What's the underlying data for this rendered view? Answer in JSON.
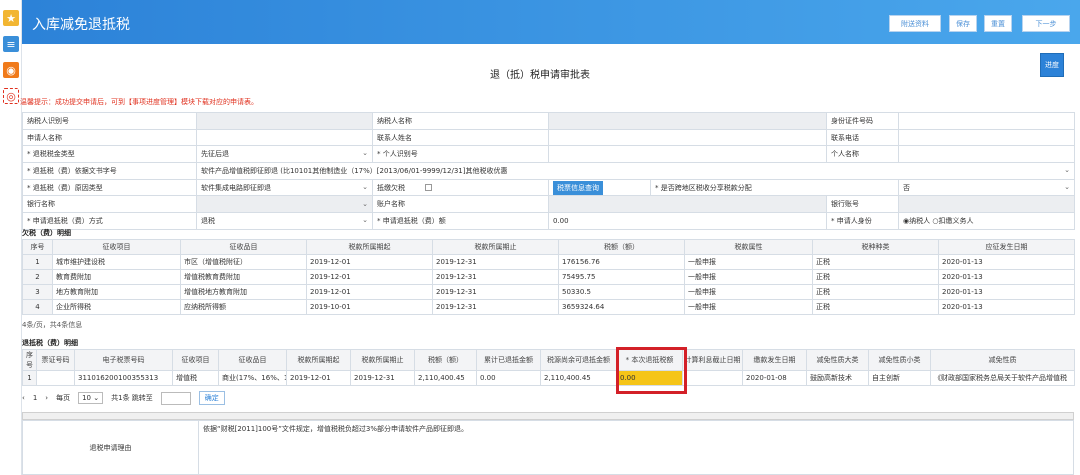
{
  "header": {
    "title": "入库减免退抵税",
    "buttons": [
      "附送资料",
      "保存",
      "重置",
      "下一步"
    ]
  },
  "main_title": "退（抵）税申请审批表",
  "progress_label": "进度",
  "tip": "温馨提示：成功提交申请后，可到【事项进度管理】模块下载对应的申请表。",
  "form": {
    "r1": [
      "纳税人识别号",
      "纳税人名称",
      "身份证件号码"
    ],
    "r2": [
      "申请人名称",
      "联系人姓名",
      "联系电话"
    ],
    "r3": [
      "* 退税税金类型",
      "先征后退",
      "* 个人识别号",
      "个人名称"
    ],
    "r4": [
      "* 退抵税（费）依据文书字号",
      "软件产品增值税即征即退 (比10101其他制造业（17%）[2013/06/01-9999/12/31]其他税收优惠"
    ],
    "r5": [
      "* 退抵税（费）原因类型",
      "软件集成电路即征即退",
      "抵缴欠税",
      "税票信息查询",
      "* 是否跨地区税收分享税款分配",
      "否"
    ],
    "r6": [
      "银行名称",
      "账户名称",
      "银行账号"
    ],
    "r7": [
      "* 申请退抵税（费）方式",
      "退税",
      "* 申请退抵税（费）额",
      "0.00",
      "* 申请人身份",
      "纳税人",
      "扣缴义务人"
    ]
  },
  "owed_section": {
    "title": "欠税（费）明细",
    "headers": [
      "序号",
      "征收项目",
      "征收品目",
      "税款所属期起",
      "税款所属期止",
      "税额（额）",
      "税款属性",
      "税种种类",
      "应征发生日期"
    ],
    "rows": [
      [
        "1",
        "城市维护建设税",
        "市区（增值税附征）",
        "2019-12-01",
        "2019-12-31",
        "176156.76",
        "一般申报",
        "正税",
        "2020-01-13"
      ],
      [
        "2",
        "教育费附加",
        "增值税教育费附加",
        "2019-12-01",
        "2019-12-31",
        "75495.75",
        "一般申报",
        "正税",
        "2020-01-13"
      ],
      [
        "3",
        "地方教育附加",
        "增值税地方教育附加",
        "2019-12-01",
        "2019-12-31",
        "50330.5",
        "一般申报",
        "正税",
        "2020-01-13"
      ],
      [
        "4",
        "企业所得税",
        "应纳税所得额",
        "2019-10-01",
        "2019-12-31",
        "3659324.64",
        "一般申报",
        "正税",
        "2020-01-13"
      ]
    ],
    "footer": "4条/页，共4条信息"
  },
  "refund_section": {
    "title": "退抵税（费）明细",
    "headers": [
      "序号",
      "票证号码",
      "电子税票号码",
      "征收项目",
      "征收品目",
      "税款所属期起",
      "税款所属期止",
      "税额（额）",
      "累计已退抵金额",
      "税源尚余可退抵金额",
      "* 本次退抵税额",
      "计算利息截止日期",
      "缴款发生日期",
      "减免性质大类",
      "减免性质小类",
      "减免性质"
    ],
    "row": [
      "1",
      "",
      "311016200100355313",
      "增值税",
      "商业(17%、16%、1…",
      "2019-12-01",
      "2019-12-31",
      "2,110,400.45",
      "0.00",
      "2,110,400.45",
      "0.00",
      "",
      "2020-01-08",
      "鼓励高新技术",
      "自主创新",
      "《财政部国家税务总局关于软件产品增值税"
    ]
  },
  "pager": {
    "page": "1",
    "per_page_label": "每页",
    "per_page": "10",
    "total": "共1条 跳转至",
    "confirm": "确定"
  },
  "reason": {
    "label": "退税申请理由",
    "text": "依据“财税[2011]100号”文件规定，增值税税负超过3%部分申请软件产品即征即退。"
  }
}
